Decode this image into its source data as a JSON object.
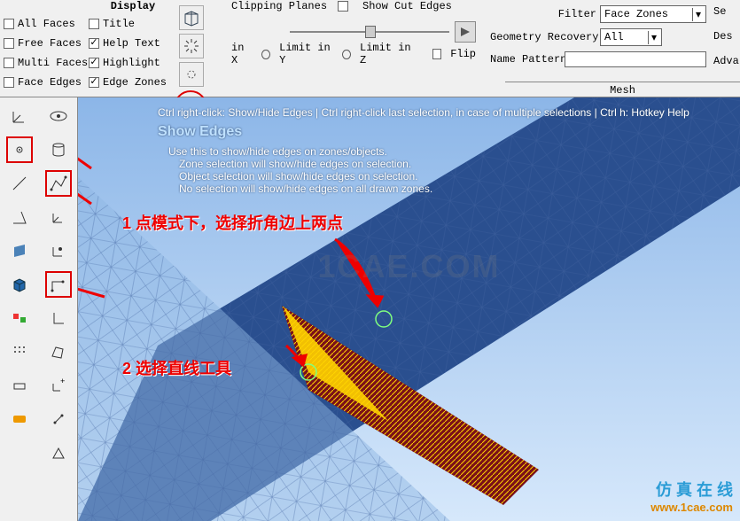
{
  "display": {
    "title": "Display",
    "rows": [
      {
        "left": {
          "checked": false,
          "label": "All Faces"
        },
        "right": {
          "checked": false,
          "label": "Title"
        }
      },
      {
        "left": {
          "checked": false,
          "label": "Free Faces"
        },
        "right": {
          "checked": true,
          "label": "Help Text"
        }
      },
      {
        "left": {
          "checked": false,
          "label": "Multi Faces"
        },
        "right": {
          "checked": true,
          "label": "Highlight"
        }
      },
      {
        "left": {
          "checked": false,
          "label": "Face Edges"
        },
        "right": {
          "checked": true,
          "label": "Edge Zones"
        }
      }
    ]
  },
  "clipping": {
    "title": "Clipping Planes",
    "show_cut": "Show Cut Edges",
    "limit_x": "in X",
    "limit_y": "Limit in Y",
    "limit_z": "Limit in Z",
    "flip": "Flip"
  },
  "filter": {
    "filter_label": "Filter",
    "filter_value": "Face Zones",
    "geom_label": "Geometry Recovery",
    "geom_value": "All",
    "name_label": "Name Pattern",
    "name_value": "",
    "btn_se": "Se",
    "btn_des": "Des",
    "btn_adv": "Advar",
    "mesh_label": "Mesh"
  },
  "help": {
    "top": "Ctrl right-click: Show/Hide Edges | Ctrl right-click last selection, in case of multiple selections | Ctrl h: Hotkey Help",
    "title": "Show Edges",
    "l1": "Use this to show/hide edges on zones/objects.",
    "l2": "Zone selection will show/hide edges on selection.",
    "l3": "Object selection will show/hide edges on selection.",
    "l4": "No selection will show/hide edges on all drawn zones."
  },
  "annotations": {
    "a1": "1 点模式下，选择折角边上两点",
    "a2": "2 选择直线工具"
  },
  "watermark": {
    "center": "1CAE.COM",
    "br1": "仿  真  在  线",
    "br2": "www.1cae.com"
  },
  "icons": {
    "cube": "cube-icon",
    "sun": "burst-icon",
    "gear": "gear-icon",
    "eye": "eye-icon",
    "play": "play-icon"
  },
  "toolbar_left": [
    "axis-icon",
    "dot-icon",
    "line-icon",
    "triangle-edge-icon",
    "plane-icon",
    "cube-solid-icon",
    "zone-icon",
    "dots-icon",
    "patch-icon",
    "badge-icon"
  ],
  "toolbar_right": [
    "view-eye-icon",
    "db-icon",
    "trace-icon",
    "axis-small-icon",
    "axis-node-icon",
    "corner-line-icon",
    "axis-l-icon",
    "region-icon",
    "plus-axis-icon",
    "nodes-icon",
    "tri-icon"
  ],
  "colors": {
    "annotate": "#e00",
    "accent": "#d00"
  }
}
